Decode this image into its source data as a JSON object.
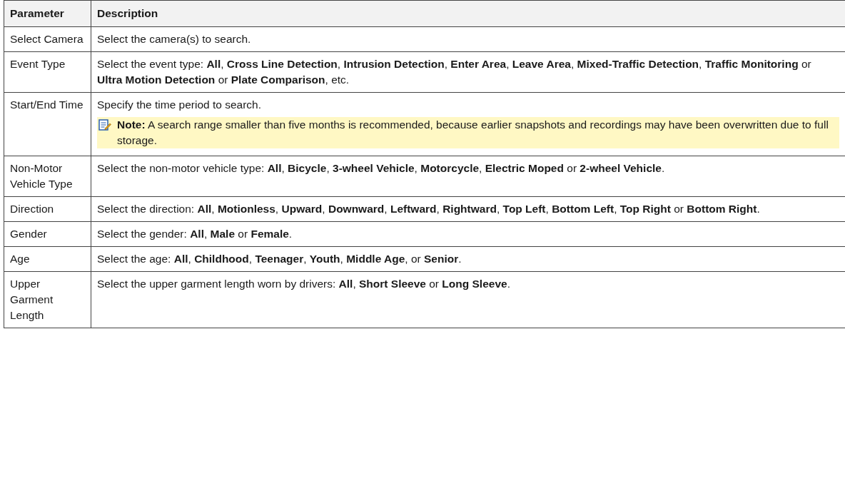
{
  "table": {
    "columns": [
      "Parameter",
      "Description"
    ],
    "rows": [
      {
        "parameter": "Select Camera",
        "description": "Select the camera(s) to search."
      },
      {
        "parameter": "Event Type",
        "description": "Select the event type: **All**, **Cross Line Detection**, **Intrusion Detection**, **Enter Area**, **Leave Area**, **Mixed-Traffic Detection**, **Traffic Monitoring** or **Ultra Motion Detection** or **Plate Comparison**, etc."
      },
      {
        "parameter": "Start/End Time",
        "description": "Specify the time period to search.",
        "note": {
          "label": "Note:",
          "text": "A search range smaller than five months is recommended, because earlier snapshots and recordings may have been overwritten due to full storage."
        }
      },
      {
        "parameter": "Non-Motor Vehicle Type",
        "description": "Select the non-motor vehicle type: **All**, **Bicycle**, **3-wheel Vehicle**, **Motorcycle**, **Electric Moped** or **2-wheel Vehicle**."
      },
      {
        "parameter": "Direction",
        "description": "Select the direction: **All**, **Motionless**, **Upward**, **Downward**, **Leftward**, **Rightward**, **Top Left**, **Bottom Left**, **Top Right** or **Bottom Right**."
      },
      {
        "parameter": "Gender",
        "description": "Select the gender: **All**, **Male** or **Female**."
      },
      {
        "parameter": "Age",
        "description": "Select the age: **All**, **Childhood**, **Teenager**, **Youth**, **Middle Age**, or **Senior**."
      },
      {
        "parameter": "Upper Garment Length",
        "description": "Select the upper garment length worn by drivers: **All**, **Short Sleeve** or **Long Sleeve**."
      }
    ]
  }
}
